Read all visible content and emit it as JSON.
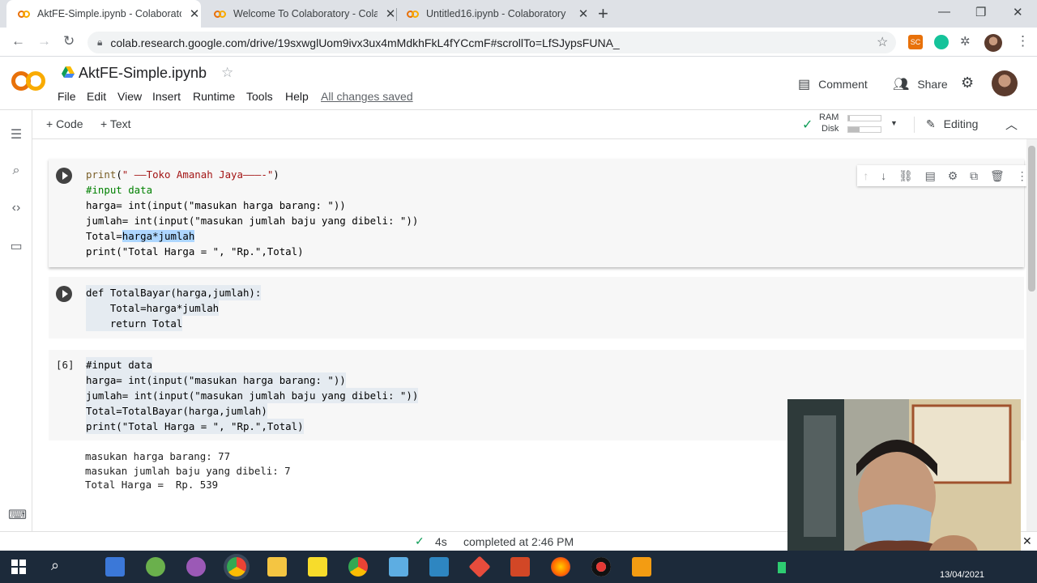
{
  "browser": {
    "tabs": [
      {
        "title": "AktFE-Simple.ipynb - Colaborato",
        "active": true
      },
      {
        "title": "Welcome To Colaboratory - Cola",
        "active": false
      },
      {
        "title": "Untitled16.ipynb - Colaboratory",
        "active": false
      }
    ],
    "close_glyph": "✕",
    "new_tab_glyph": "+",
    "url": "colab.research.google.com/drive/19sxwglUom9ivx3ux4mMdkhFkL4fYCcmF#scrollTo=LfSJypsFUNA_"
  },
  "colab": {
    "notebook_title": "AktFE-Simple.ipynb",
    "menu": [
      "File",
      "Edit",
      "View",
      "Insert",
      "Runtime",
      "Tools",
      "Help"
    ],
    "save_status": "All changes saved",
    "comment_label": "Comment",
    "share_label": "Share",
    "add_code_label": "+ Code",
    "add_text_label": "+ Text",
    "ram_label": "RAM",
    "disk_label": "Disk",
    "ram_fill": 0.05,
    "disk_fill": 0.35,
    "editing_label": "Editing"
  },
  "cells": {
    "cell1_lines": [
      "print(\" ——Toko Amanah Jaya———-\")",
      "#input data",
      "harga= int(input(\"masukan harga barang: \"))",
      "jumlah= int(input(\"masukan jumlah baju yang dibeli: \"))",
      "Total=harga*jumlah",
      "print(\"Total Harga = \", \"Rp.\",Total)"
    ],
    "cell2_lines": [
      "def TotalBayar(harga,jumlah):",
      "    Total=harga*jumlah",
      "    return Total"
    ],
    "cell3_exec_count": "[6]",
    "cell3_lines": [
      "#input data",
      "harga= int(input(\"masukan harga barang: \"))",
      "jumlah= int(input(\"masukan jumlah baju yang dibeli: \"))",
      "Total=TotalBayar(harga,jumlah)",
      "print(\"Total Harga = \", \"Rp.\",Total)"
    ],
    "cell3_output": [
      "masukan harga barang: 77",
      "masukan jumlah baju yang dibeli: 7",
      "Total Harga =  Rp. 539"
    ]
  },
  "status": {
    "duration": "4s",
    "completed": "completed at 2:46 PM"
  },
  "taskbar": {
    "date_partial": "13/04/2021"
  },
  "colors": {
    "colab_orange": "#f9ab00",
    "colab_dark_orange": "#e8710a",
    "check_green": "#0f9d58",
    "taskbar_bg": "#1c2a3a"
  }
}
